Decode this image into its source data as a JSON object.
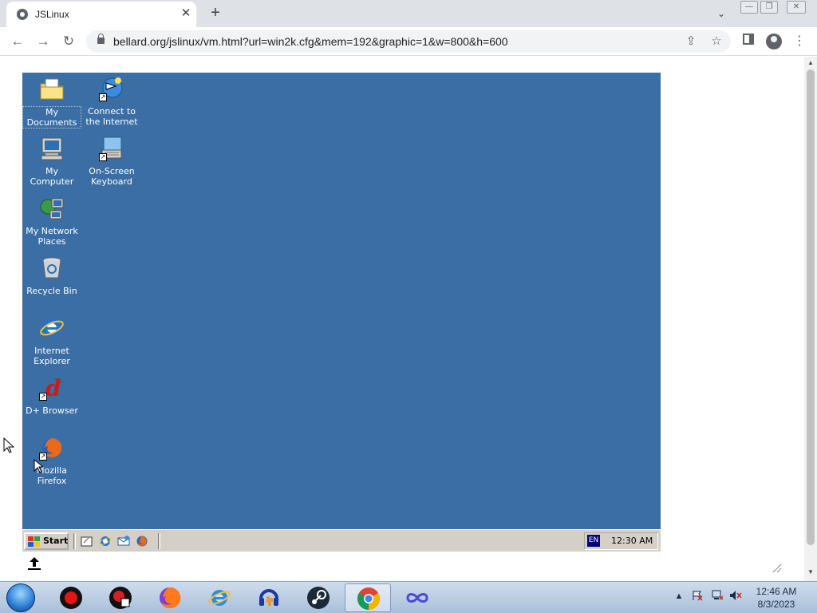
{
  "browser": {
    "tab_title": "JSLinux",
    "tab_close_glyph": "✕",
    "new_tab_glyph": "+",
    "address": "bellard.org/jslinux/vm.html?url=win2k.cfg&mem=192&graphic=1&w=800&h=600",
    "nav": {
      "back": "←",
      "forward": "→",
      "reload": "↻"
    },
    "omnibox_icons": {
      "share": "⇪",
      "bookmark": "☆"
    },
    "menu_glyph": "⋮"
  },
  "vm": {
    "background_color": "#3a6ea5",
    "desktop_icons": [
      {
        "id": "my-documents",
        "label": "My Documents",
        "icon": "folder-documents-icon"
      },
      {
        "id": "connect-internet",
        "label": "Connect to the Internet",
        "icon": "connect-wizard-icon",
        "shortcut": true
      },
      {
        "id": "my-computer",
        "label": "My Computer",
        "icon": "computer-icon"
      },
      {
        "id": "on-screen-keyboard",
        "label": "On-Screen Keyboard",
        "icon": "keyboard-icon",
        "shortcut": true
      },
      {
        "id": "network-places",
        "label": "My Network Places",
        "icon": "network-icon"
      },
      {
        "id": "recycle-bin",
        "label": "Recycle Bin",
        "icon": "recycle-bin-icon"
      },
      {
        "id": "internet-explorer",
        "label": "Internet Explorer",
        "icon": "ie-icon"
      },
      {
        "id": "dplus-browser",
        "label": "D+ Browser",
        "icon": "dplus-icon",
        "shortcut": true
      },
      {
        "id": "mozilla-firefox",
        "label": "Mozilla Firefox",
        "icon": "firefox-icon",
        "shortcut": true
      }
    ],
    "taskbar": {
      "start_label": "Start",
      "quick_launch": [
        "desktop-icon",
        "ie-icon",
        "outlook-icon",
        "firefox-icon"
      ],
      "language": "EN",
      "clock": "12:30 AM"
    }
  },
  "host_taskbar": {
    "apps": [
      "record-icon",
      "obs-icon",
      "firefox-icon",
      "ie-icon",
      "audacity-icon",
      "steam-icon",
      "chrome-icon",
      "infinity-icon"
    ],
    "active_app": "chrome-icon",
    "time": "12:46 AM",
    "date": "8/3/2023"
  }
}
